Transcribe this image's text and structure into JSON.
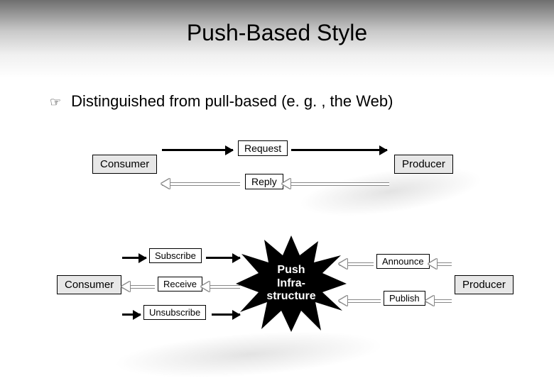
{
  "title": "Push-Based Style",
  "bullet": "Distinguished from pull-based (e. g. , the Web)",
  "top": {
    "consumer": "Consumer",
    "producer": "Producer",
    "request": "Request",
    "reply": "Reply"
  },
  "bottom": {
    "consumer": "Consumer",
    "producer": "Producer",
    "subscribe": "Subscribe",
    "receive": "Receive",
    "unsubscribe": "Unsubscribe",
    "announce": "Announce",
    "publish": "Publish",
    "infra_line1": "Push",
    "infra_line2": "Infra-",
    "infra_line3": "structure"
  }
}
